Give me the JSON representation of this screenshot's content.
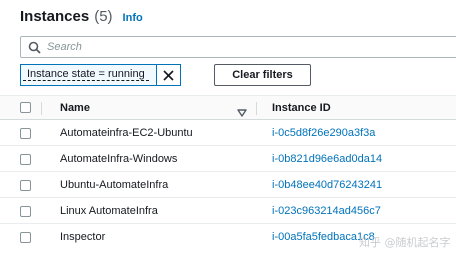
{
  "header": {
    "title": "Instances",
    "count": "(5)",
    "info_link": "Info"
  },
  "search": {
    "placeholder": "Search",
    "value": ""
  },
  "filter_token": {
    "label": "Instance state = running"
  },
  "clear_filters_label": "Clear filters",
  "table": {
    "columns": [
      "Name",
      "Instance ID"
    ],
    "rows": [
      {
        "name": "Automateinfra-EC2-Ubuntu",
        "instance_id": "i-0c5d8f26e290a3f3a"
      },
      {
        "name": "AutomateInfra-Windows",
        "instance_id": "i-0b821d96e6ad0da14"
      },
      {
        "name": "Ubuntu-AutomateInfra",
        "instance_id": "i-0b48ee40d76243241"
      },
      {
        "name": "Linux AutomateInfra",
        "instance_id": "i-023c963214ad456c7"
      },
      {
        "name": "Inspector",
        "instance_id": "i-00a5fa5fedbaca1c8"
      }
    ]
  },
  "watermark": "知乎 @随机起名字",
  "colors": {
    "link": "#0073bb",
    "text": "#16191f",
    "border": "#aab7b8"
  }
}
